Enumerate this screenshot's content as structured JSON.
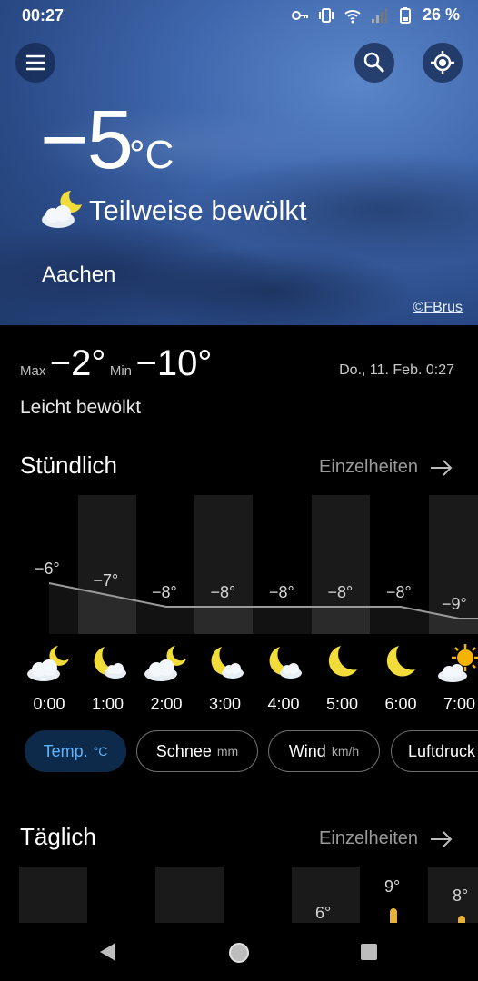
{
  "status": {
    "time": "00:27",
    "battery": "26 %",
    "icons": [
      "key-icon",
      "vibrate-icon",
      "wifi-icon",
      "signal-icon",
      "battery-icon"
    ]
  },
  "hero": {
    "temp": "−5",
    "unit": "°C",
    "condition": "Teilweise bewölkt",
    "city": "Aachen",
    "credit": "©FBrus"
  },
  "today": {
    "max_label": "Max",
    "max_value": "−2°",
    "min_label": "Min",
    "min_value": "−10°",
    "date": "Do., 11. Feb. 0:27",
    "description": "Leicht bewölkt"
  },
  "hourly": {
    "title": "Stündlich",
    "details": "Einzelheiten",
    "temps": [
      -6,
      -7,
      -8,
      -8,
      -8,
      -8,
      -8,
      -9
    ],
    "temp_labels": [
      "−6°",
      "−7°",
      "−8°",
      "−8°",
      "−8°",
      "−8°",
      "−8°",
      "−9°"
    ],
    "hours": [
      "0:00",
      "1:00",
      "2:00",
      "3:00",
      "4:00",
      "5:00",
      "6:00",
      "7:00"
    ],
    "icons": [
      "cloud-moon-icon",
      "moon-cloud-icon",
      "cloud-moon-icon",
      "moon-cloud-icon",
      "moon-cloud-icon",
      "moon-icon",
      "moon-icon",
      "sun-cloud-icon"
    ]
  },
  "chips": [
    {
      "label": "Temp.",
      "unit": "°C"
    },
    {
      "label": "Schnee",
      "unit": "mm"
    },
    {
      "label": "Wind",
      "unit": "km/h"
    },
    {
      "label": "Luftdruck",
      "unit": ""
    }
  ],
  "daily": {
    "title": "Täglich",
    "details": "Einzelheiten",
    "visible_labels": [
      "6°",
      "9°",
      "8°"
    ]
  },
  "colors": {
    "accent": "#5fb2ff",
    "moon": "#f2dc3a",
    "sun": "#f5b400",
    "panel": "#1a1a1a"
  }
}
